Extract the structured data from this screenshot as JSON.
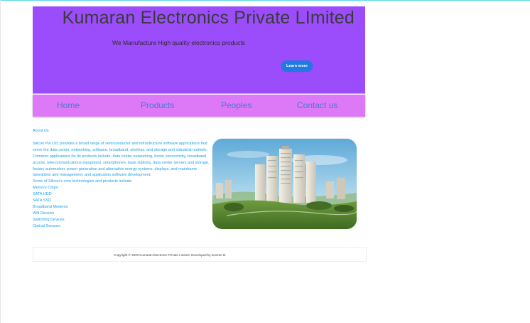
{
  "header": {
    "title": "Kumaran Electronics Private LImited",
    "tagline": "We Manufacture High quality electronics  products",
    "learn_more_label": "Learn more"
  },
  "nav": {
    "items": [
      "Home",
      "Products",
      "Peoples",
      "Contact us"
    ]
  },
  "about": {
    "heading": "About Us",
    "paragraph": "Silicon Pvt Ltd, provides a broad range of semiconductor and infrastructure software applications that serve the data center, networking, software, broadband, wireless, and storage and industrial markets. Common applications for its products include: data center networking, home connectivity, broadband access, telecommunications equipment, smartphones, base stations, data center servers and storage, factory automation, power generation and alternative energy systems, displays, and mainframe operations and management, and application software development.",
    "products_intro": "Some of Silicon's core technologies and products include:",
    "products": [
      "Memory Chips",
      "SATA HDD",
      "SATA SSD",
      "Broadband Modems",
      "Wifi Devices",
      "Switching Devices",
      "Optical Sensors"
    ]
  },
  "hero": {
    "icon": "city-buildings-photo"
  },
  "footer": {
    "copyright": "Copyright © 2020 Kumaran Electronic Private Limited, Developed by kumran B."
  },
  "colors": {
    "banner": "#9c4dfb",
    "navbar": "#dd78f7",
    "nav_text": "#4a78d8",
    "body_text": "#1ea0e8",
    "button": "#1f7ae3"
  }
}
